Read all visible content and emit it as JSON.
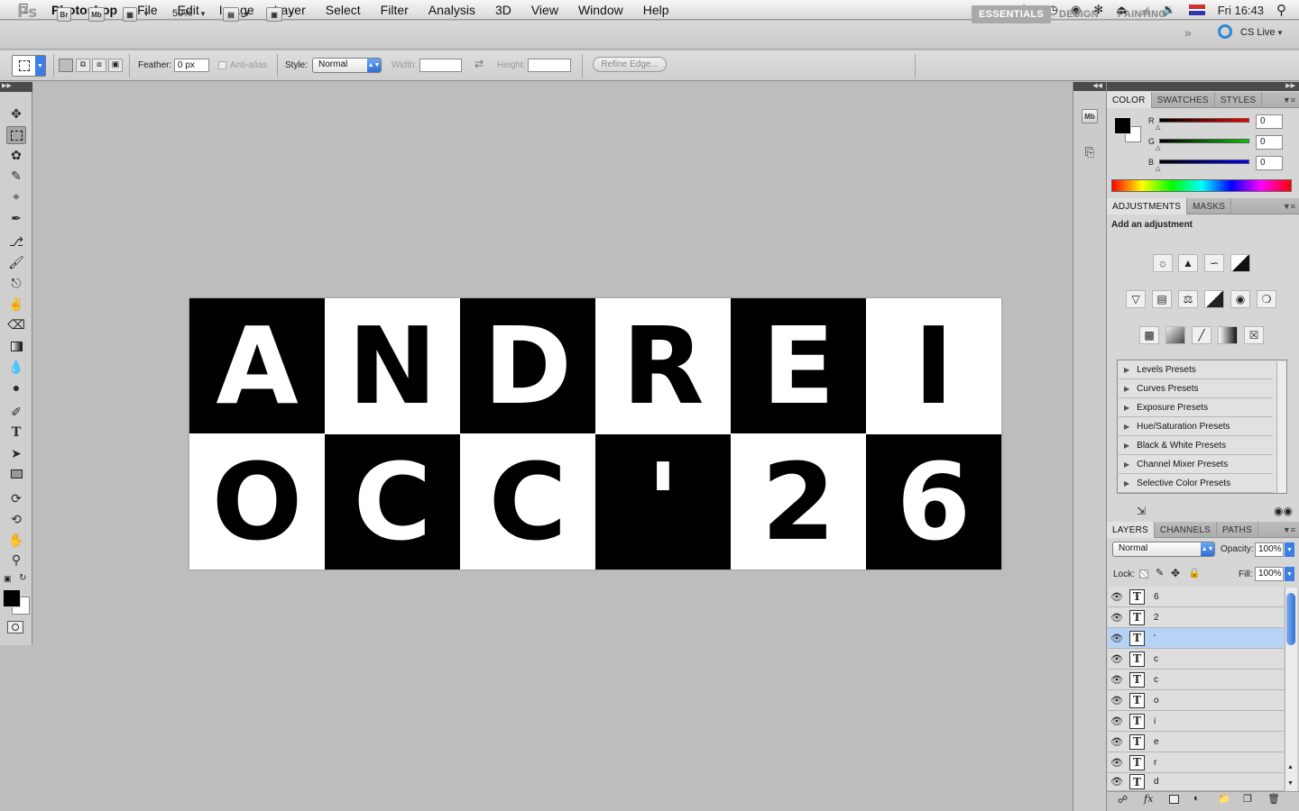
{
  "menubar": {
    "app_name": "Photoshop",
    "items": [
      "File",
      "Edit",
      "Image",
      "Layer",
      "Select",
      "Filter",
      "Analysis",
      "3D",
      "View",
      "Window",
      "Help"
    ],
    "status": {
      "adobe_badge": "2",
      "clock": "Fri 16:43"
    }
  },
  "appbar": {
    "logo": "Ps",
    "bridge": "Br",
    "minibridge": "Mb",
    "zoom": "50%",
    "workspaces": [
      "ESSENTIALS",
      "DESIGN",
      "PAINTING"
    ],
    "active_workspace": "ESSENTIALS",
    "cs_live": "CS Live"
  },
  "options": {
    "feather_label": "Feather:",
    "feather_value": "0 px",
    "antialias_label": "Anti-alias",
    "style_label": "Style:",
    "style_value": "Normal",
    "width_label": "Width:",
    "height_label": "Height:",
    "refine_edge": "Refine Edge..."
  },
  "canvas": {
    "cells": [
      {
        "char": "A",
        "color": "black"
      },
      {
        "char": "N",
        "color": "white"
      },
      {
        "char": "D",
        "color": "black"
      },
      {
        "char": "R",
        "color": "white"
      },
      {
        "char": "E",
        "color": "black"
      },
      {
        "char": "I",
        "color": "white"
      },
      {
        "char": "O",
        "color": "white"
      },
      {
        "char": "C",
        "color": "black"
      },
      {
        "char": "C",
        "color": "white"
      },
      {
        "char": "'",
        "color": "black"
      },
      {
        "char": "2",
        "color": "white"
      },
      {
        "char": "6",
        "color": "black"
      }
    ]
  },
  "color_panel": {
    "tabs": [
      "COLOR",
      "SWATCHES",
      "STYLES"
    ],
    "active_tab": "COLOR",
    "r_label": "R",
    "g_label": "G",
    "b_label": "B",
    "r": "0",
    "g": "0",
    "b": "0",
    "foreground": "#000000",
    "background": "#ffffff"
  },
  "adjustments_panel": {
    "tabs": [
      "ADJUSTMENTS",
      "MASKS"
    ],
    "active_tab": "ADJUSTMENTS",
    "heading": "Add an adjustment",
    "presets": [
      "Levels Presets",
      "Curves Presets",
      "Exposure Presets",
      "Hue/Saturation Presets",
      "Black & White Presets",
      "Channel Mixer Presets",
      "Selective Color Presets"
    ]
  },
  "layers_panel": {
    "tabs": [
      "LAYERS",
      "CHANNELS",
      "PATHS"
    ],
    "active_tab": "LAYERS",
    "blend_mode": "Normal",
    "opacity_label": "Opacity:",
    "opacity": "100%",
    "lock_label": "Lock:",
    "fill_label": "Fill:",
    "fill": "100%",
    "layers": [
      "6",
      "2",
      "'",
      "c",
      "c",
      "o",
      "i",
      "e",
      "r",
      "d"
    ],
    "active_layer_index": 2
  }
}
